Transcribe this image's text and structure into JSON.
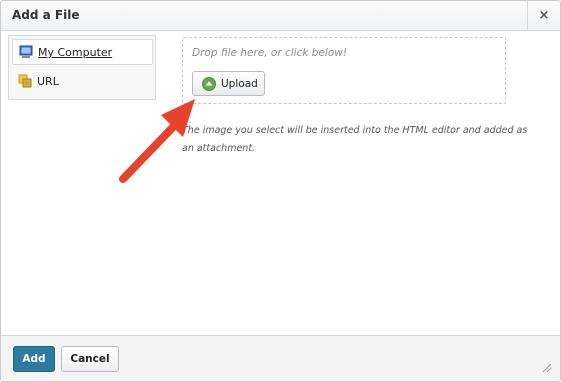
{
  "dialog": {
    "title": "Add a File",
    "close_label": "×"
  },
  "sources": [
    {
      "label": "My Computer",
      "icon": "computer-icon",
      "selected": true
    },
    {
      "label": "URL",
      "icon": "url-icon",
      "selected": false
    }
  ],
  "upload": {
    "drop_hint": "Drop file here, or click below!",
    "button_label": "Upload",
    "button_icon": "upload-icon",
    "help_text": "The image you select will be inserted into the HTML editor and added as an attachment."
  },
  "footer": {
    "add_label": "Add",
    "cancel_label": "Cancel"
  },
  "colors": {
    "primary_button": "#2e7ba0",
    "annotation_arrow": "#e8412c",
    "upload_icon": "#6aa84f"
  }
}
